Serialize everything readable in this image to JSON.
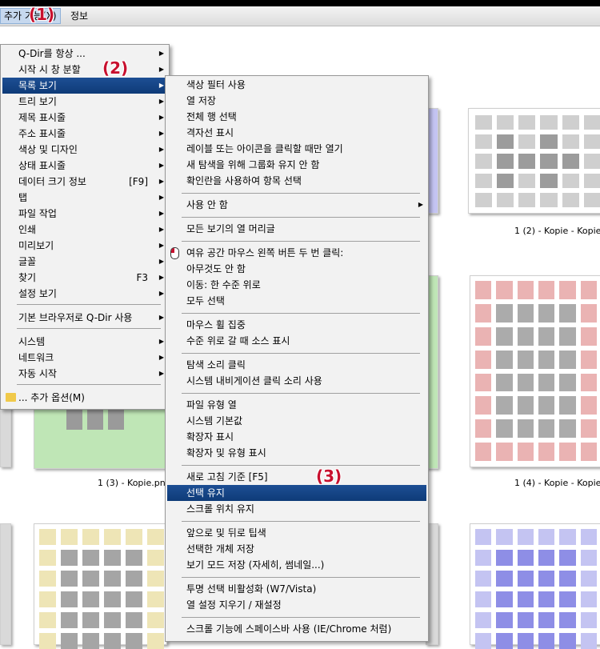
{
  "menubar": {
    "extra_label": "추가 기능(X)",
    "info_label": "정보"
  },
  "callouts": {
    "c1": "(1)",
    "c2": "(2)",
    "c3": "(3)"
  },
  "main_menu": {
    "items": [
      {
        "label": "Q-Dir를 항상 ...",
        "arrow": "▶"
      },
      {
        "label": "시작 시 창 분할",
        "arrow": "▶"
      },
      {
        "label": "목록 보기",
        "arrow": "▶"
      },
      {
        "label": "트리 보기",
        "arrow": "▶"
      },
      {
        "label": "제목 표시줄",
        "arrow": "▶"
      },
      {
        "label": "주소 표시줄",
        "arrow": "▶"
      },
      {
        "label": "색상 및 디자인",
        "arrow": "▶"
      },
      {
        "label": "상태 표시줄",
        "arrow": "▶"
      },
      {
        "label": "데이터 크기 정보",
        "shortcut": "[F9]",
        "arrow": "▶"
      },
      {
        "label": "탭",
        "arrow": "▶"
      },
      {
        "label": "파일 작업",
        "arrow": "▶"
      },
      {
        "label": "인쇄",
        "arrow": "▶"
      },
      {
        "label": "미리보기",
        "arrow": "▶"
      },
      {
        "label": "글꼴",
        "arrow": "▶"
      },
      {
        "label": "찾기",
        "shortcut": "F3",
        "arrow": "▶"
      },
      {
        "label": "설정 보기",
        "arrow": "▶"
      },
      {
        "label": "기본 브라우저로 Q-Dir 사용",
        "arrow": "▶"
      },
      {
        "label": "시스템",
        "arrow": "▶"
      },
      {
        "label": "네트워크",
        "arrow": "▶"
      },
      {
        "label": "자동 시작",
        "arrow": "▶"
      },
      {
        "label": "... 추가 옵션(M)"
      }
    ]
  },
  "sub_menu": {
    "items": [
      {
        "label": "색상 필터 사용"
      },
      {
        "label": "열 저장"
      },
      {
        "label": "전체 행 선택"
      },
      {
        "label": "격자선 표시"
      },
      {
        "label": "레이블 또는 아이콘을 클릭할 때만 열기"
      },
      {
        "label": "새 탐색을 위해 그룹화 유지 안 함"
      },
      {
        "label": "확인란을 사용하여 항목 선택"
      },
      {
        "label": "사용 안 함",
        "arrow": "▶"
      },
      {
        "label": "모든 보기의 열 머리글"
      },
      {
        "label": "여유 공간 마우스 왼쪽 버튼 두 번 클릭:"
      },
      {
        "label": "아무것도 안 함"
      },
      {
        "label": "이동: 한 수준 위로"
      },
      {
        "label": "모두 선택"
      },
      {
        "label": "마우스 휠 집중"
      },
      {
        "label": "수준 위로 갈 때 소스 표시"
      },
      {
        "label": "탐색 소리 클릭"
      },
      {
        "label": "시스템 내비게이션 클릭 소리 사용"
      },
      {
        "label": "파일 유형 열"
      },
      {
        "label": "시스템 기본값"
      },
      {
        "label": "확장자 표시"
      },
      {
        "label": "확장자 및 유형 표시"
      },
      {
        "label": "새로 고침 기준 [F5]"
      },
      {
        "label": "선택 유지"
      },
      {
        "label": "스크롤 위치 유지"
      },
      {
        "label": "앞으로 및 뒤로 팁색"
      },
      {
        "label": "선택한 개체 저장"
      },
      {
        "label": "보기 모드 저장 (자세히, 썸네일...)"
      },
      {
        "label": "투명 선택 비활성화 (W7/Vista)"
      },
      {
        "label": "열 설정 지우기 / 재설정"
      },
      {
        "label": "스크롤 기능에 스페이스바 사용 (IE/Chrome 처럼)"
      }
    ]
  },
  "thumbnails": {
    "cap_top_right": "1 (2) - Kopie - Kopie.",
    "cap_mid_left": "1 (3) - Kopie.png",
    "cap_mid_right": "1 (4) - Kopie - Kopie."
  },
  "colors": {
    "menu_highlight": "#0e3b78",
    "thumb_gray": "#cfcfcf",
    "thumb_gray_dark": "#9c9c9c",
    "thumb_blue": "#c4c4f2",
    "thumb_blue_dark": "#8e8ee6",
    "thumb_green": "#bfe6b6",
    "thumb_green_dark": "#9a9a9a",
    "thumb_red": "#eab3b3",
    "thumb_red_dark": "#ababab",
    "thumb_yellow": "#eee5b6",
    "thumb_yellow_dark": "#a5a5a5"
  }
}
